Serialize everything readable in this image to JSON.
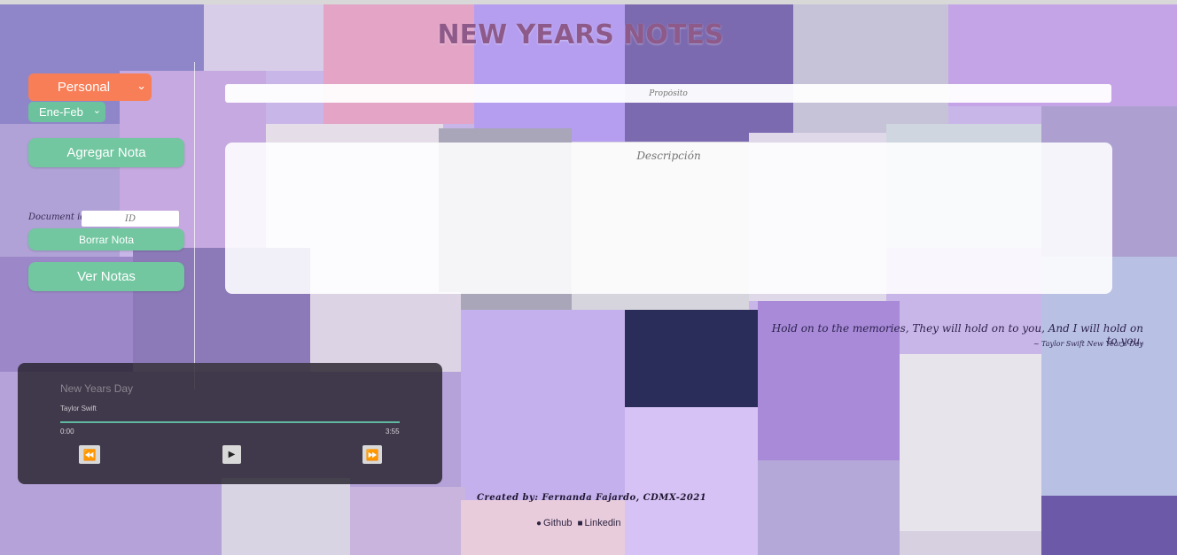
{
  "app": {
    "title": "NEW YEARS NOTES"
  },
  "colors": {
    "accent": "#72c6a0",
    "category": "#f87e57",
    "title": "#8e5a8a",
    "player_bg": "#26222c"
  },
  "form": {
    "category_value": "Personal",
    "period_value": "Ene-Feb",
    "add_button": "Agregar Nota",
    "doc_label": "Document id:",
    "doc_placeholder": "ID",
    "delete_button": "Borrar Nota",
    "view_button": "Ver Notas",
    "proposito_placeholder": "Propósito",
    "descripcion_placeholder": "Descripción"
  },
  "quote": {
    "text": "Hold on to the memories, They will hold on to you, And I will hold on to you.",
    "author": "~ Taylor Swift New Year's Day"
  },
  "player": {
    "song": "New Years Day",
    "artist": "Taylor Swift",
    "current_time": "0:00",
    "total_time": "3:55",
    "progress": 0,
    "icons": {
      "prev": "rewind-icon",
      "play": "play-icon",
      "next": "fast-forward-icon"
    }
  },
  "footer": {
    "credit": "Created by: Fernanda Fajardo, CDMX-2021",
    "github": "Github",
    "linkedin": "Linkedin"
  }
}
